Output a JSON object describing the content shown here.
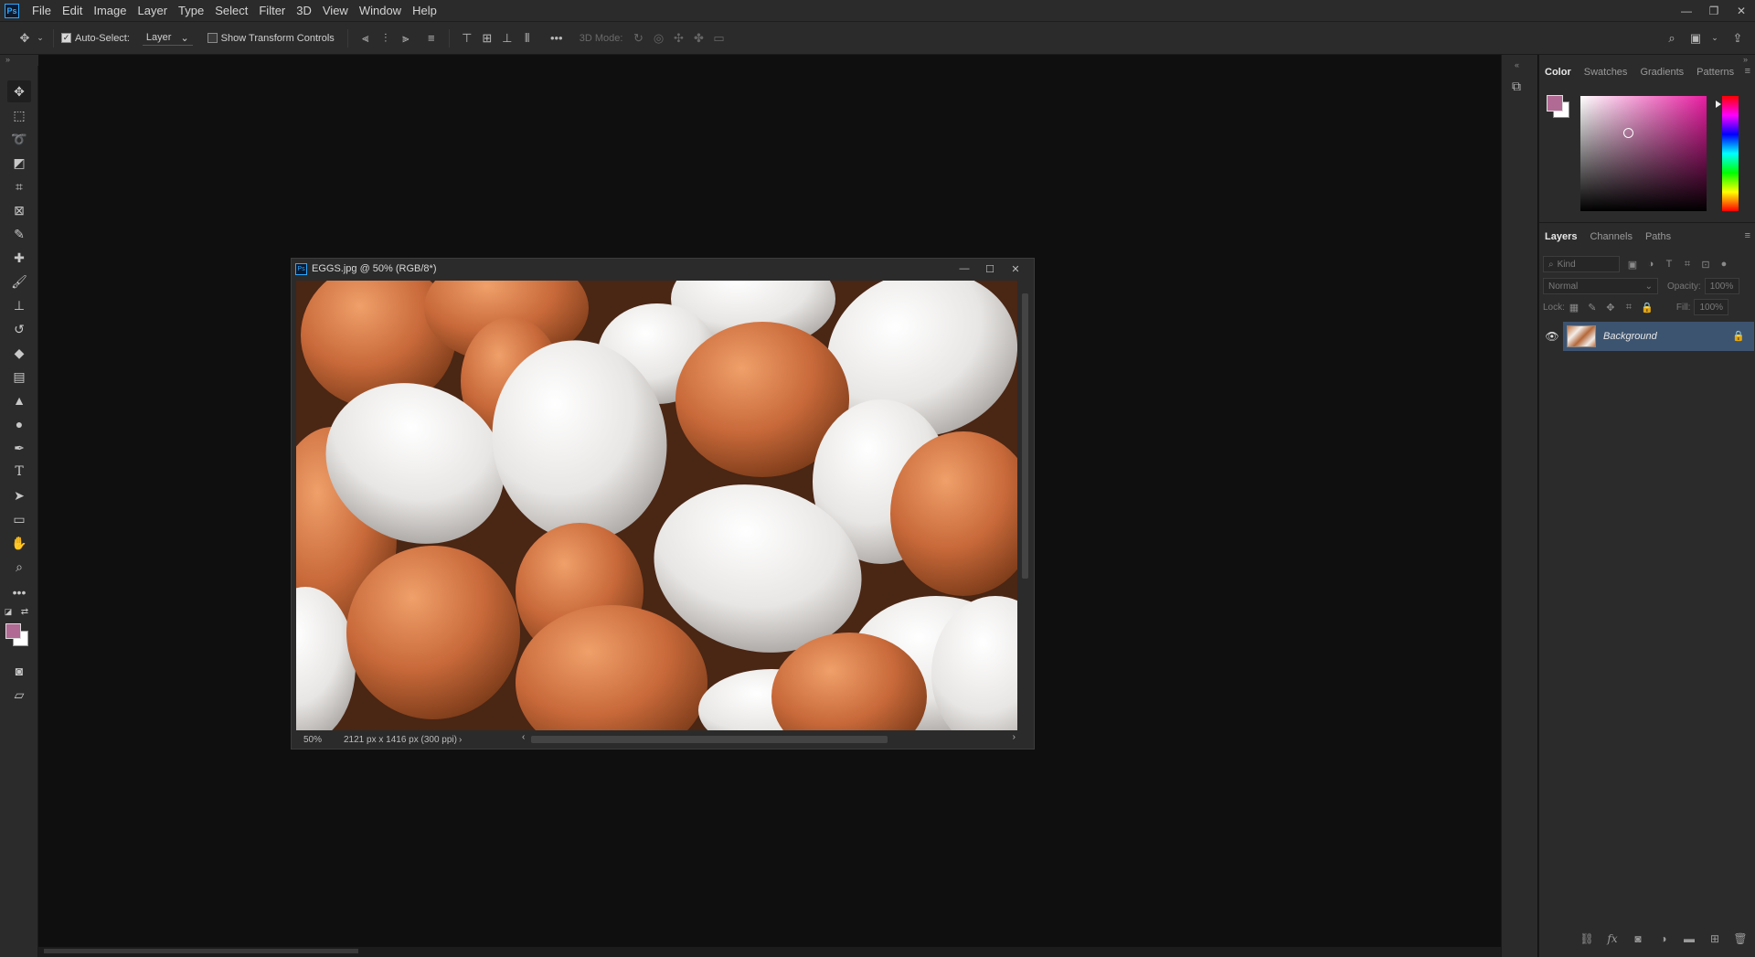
{
  "menubar": {
    "items": [
      "File",
      "Edit",
      "Image",
      "Layer",
      "Type",
      "Select",
      "Filter",
      "3D",
      "View",
      "Window",
      "Help"
    ]
  },
  "options": {
    "auto_select_label": "Auto-Select:",
    "auto_select_checked": true,
    "auto_select_target": "Layer",
    "show_transform_label": "Show Transform Controls",
    "show_transform_checked": false,
    "mode_3d_label": "3D Mode:",
    "more": "•••"
  },
  "document": {
    "title": "EGGS.jpg @ 50% (RGB/8*)",
    "zoom": "50%",
    "info": "2121 px x 1416 px (300 ppi)"
  },
  "colors": {
    "foreground": "#b06a93",
    "background": "#ffffff",
    "accent": "#31a8ff",
    "layer_selected": "#3d5470"
  },
  "color_panel": {
    "tabs": [
      "Color",
      "Swatches",
      "Gradients",
      "Patterns"
    ],
    "active_tab": "Color"
  },
  "layers_panel": {
    "tabs": [
      "Layers",
      "Channels",
      "Paths"
    ],
    "active_tab": "Layers",
    "kind_placeholder": "Kind",
    "blend_mode": "Normal",
    "opacity_label": "Opacity:",
    "opacity_value": "100%",
    "lock_label": "Lock:",
    "fill_label": "Fill:",
    "fill_value": "100%",
    "layers": [
      {
        "name": "Background",
        "visible": true,
        "locked": true,
        "selected": true
      }
    ]
  }
}
